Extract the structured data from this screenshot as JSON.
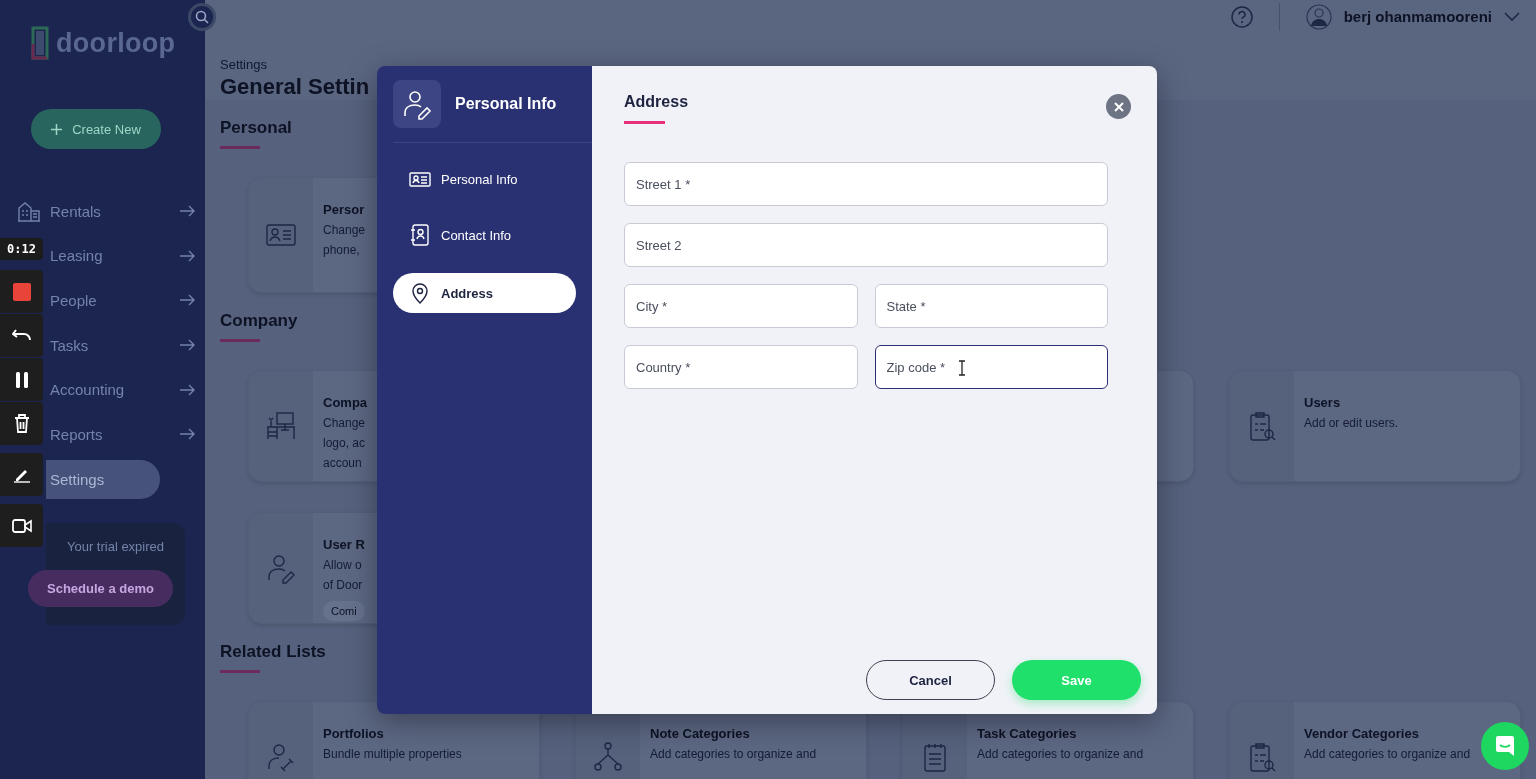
{
  "recorder": {
    "timer": "0:12",
    "tools": [
      {
        "kind": "stop"
      },
      {
        "kind": "undo"
      },
      {
        "kind": "pause"
      },
      {
        "kind": "trash"
      },
      {
        "kind": "pen"
      },
      {
        "kind": "camera"
      }
    ]
  },
  "sidebar": {
    "logo": "doorloop",
    "create_button": "Create New",
    "items": [
      {
        "label": "Rentals",
        "selected": false
      },
      {
        "label": "Leasing",
        "selected": false
      },
      {
        "label": "People",
        "selected": false
      },
      {
        "label": "Tasks",
        "selected": false
      },
      {
        "label": "Accounting",
        "selected": false
      },
      {
        "label": "Reports",
        "selected": false
      },
      {
        "label": "Settings",
        "selected": true
      }
    ],
    "trial": {
      "text": "Your trial expired",
      "button": "Schedule a demo"
    }
  },
  "topbar": {
    "user_name": "berj ohanmamooreni"
  },
  "page": {
    "breadcrumb": "Settings",
    "title": "General Settin",
    "sections": [
      {
        "title": "Personal",
        "rows": [
          [
            {
              "kind": "card",
              "title": "Persor",
              "lines": [
                "Change",
                "phone,"
              ]
            }
          ]
        ]
      },
      {
        "title": "Company",
        "rows": [
          [
            {
              "kind": "card",
              "title": "Compa",
              "lines": [
                "Change",
                "logo, ac",
                "accoun"
              ]
            },
            {
              "kind": "blank"
            },
            {
              "kind": "card",
              "title": "Users",
              "lines": [
                "Add or edit users."
              ]
            }
          ],
          [
            {
              "kind": "card",
              "title": "User R",
              "lines": [
                "Allow o",
                "of Door"
              ],
              "badge": "Comi"
            }
          ]
        ]
      },
      {
        "title": "Related Lists",
        "rows": [
          [
            {
              "kind": "card",
              "title": "Portfolios",
              "lines": [
                "Bundle multiple properties"
              ]
            },
            {
              "kind": "card",
              "title": "Note Categories",
              "lines": [
                "Add categories to organize and"
              ]
            },
            {
              "kind": "card",
              "title": "Task Categories",
              "lines": [
                "Add categories to organize and"
              ]
            },
            {
              "kind": "card",
              "title": "Vendor Categories",
              "lines": [
                "Add categories to organize and"
              ]
            }
          ]
        ]
      }
    ]
  },
  "dialog": {
    "header": "Personal Info",
    "nav": [
      {
        "label": "Personal Info",
        "selected": false
      },
      {
        "label": "Contact Info",
        "selected": false
      },
      {
        "label": "Address",
        "selected": true
      }
    ],
    "heading": "Address",
    "fields": [
      [
        {
          "placeholder": "Street 1 *",
          "focused": false
        }
      ],
      [
        {
          "placeholder": "Street 2",
          "focused": false
        }
      ],
      [
        {
          "placeholder": "City *",
          "focused": false
        },
        {
          "placeholder": "State *",
          "focused": false
        }
      ],
      [
        {
          "placeholder": "Country *",
          "focused": false
        },
        {
          "placeholder": "Zip code *",
          "focused": true
        }
      ]
    ],
    "cancel": "Cancel",
    "save": "Save"
  }
}
